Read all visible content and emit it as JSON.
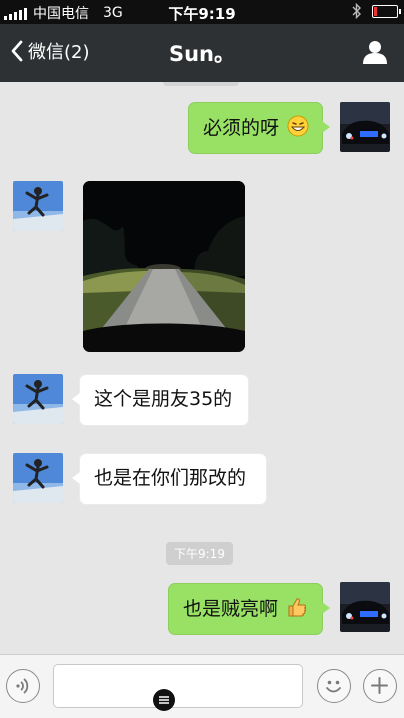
{
  "status_bar": {
    "carrier": "中国电信",
    "network": "3G",
    "time": "下午9:19",
    "battery_level": 0.15
  },
  "nav": {
    "back_label": "微信(2)",
    "title": "Sun。",
    "icons": {
      "back": "chevron-left-icon",
      "profile": "person-icon"
    }
  },
  "messages": [
    {
      "side": "right",
      "kind": "text",
      "text": "必须的呀",
      "emoji": "grinning-face"
    },
    {
      "side": "left",
      "kind": "image",
      "image_desc": "night road with headlights"
    },
    {
      "side": "left",
      "kind": "text",
      "text": "这个是朋友35的"
    },
    {
      "side": "left",
      "kind": "text",
      "text": "也是在你们那改的"
    },
    {
      "side": "center",
      "kind": "timestamp",
      "text": "下午9:19"
    },
    {
      "side": "right",
      "kind": "text",
      "text": "也是贼亮啊",
      "emoji": "thumbs-up"
    }
  ],
  "input_bar": {
    "placeholder": "",
    "icons": {
      "voice": "voice-icon",
      "emoji": "smiley-icon",
      "more": "plus-icon"
    }
  },
  "colors": {
    "status_bar": "#0f0f0f",
    "nav_bar": "#2e3133",
    "chat_bg": "#e6e6e6",
    "bubble_green": "#98e165",
    "bubble_white": "#ffffff",
    "timestamp_chip": "#cfcfcf",
    "battery_low": "#e33333"
  }
}
